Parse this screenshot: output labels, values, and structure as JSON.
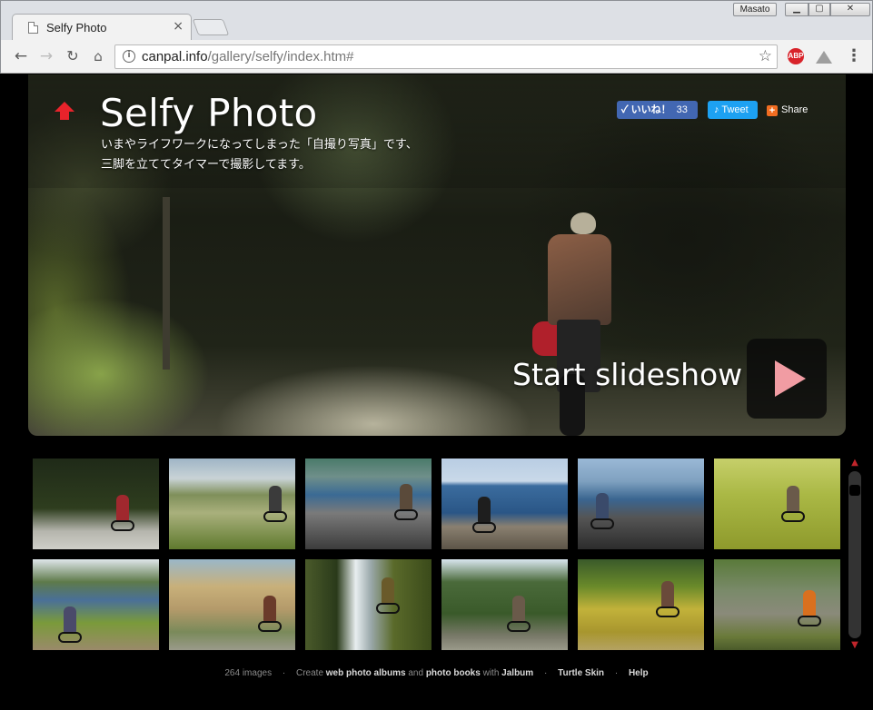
{
  "browser": {
    "tab_title": "Selfy Photo",
    "tab_close": "×",
    "profile_name": "Masato",
    "url_host": "canpal.info",
    "url_path": "/gallery/selfy/index.htm#",
    "icons": [
      "page-icon",
      "back-icon",
      "forward-icon",
      "reload-icon",
      "home-icon",
      "info-icon",
      "star-icon",
      "adblock-icon",
      "drive-icon",
      "menu-icon"
    ]
  },
  "hero": {
    "title": "Selfy Photo",
    "description_line1": "いまやライフワークになってしまった「自撮り写真」です、",
    "description_line2": "三脚を立ててタイマーで撮影してます。",
    "like_label": "いいね！",
    "like_count": "33",
    "tweet_label": "Tweet",
    "share_label": "Share",
    "slideshow_label": "Start slideshow",
    "accent_color": "#e8232b",
    "play_color": "#f19ca3"
  },
  "thumbnails": [
    {
      "scene": "forest-road"
    },
    {
      "scene": "park-steps"
    },
    {
      "scene": "seaside-road"
    },
    {
      "scene": "sea-backlit"
    },
    {
      "scene": "sea-road"
    },
    {
      "scene": "rice-field"
    },
    {
      "scene": "village-river"
    },
    {
      "scene": "old-house"
    },
    {
      "scene": "waterfall"
    },
    {
      "scene": "mountain-village"
    },
    {
      "scene": "rice-terrace"
    },
    {
      "scene": "rural-path"
    }
  ],
  "footer": {
    "count": "264 images",
    "create_text": "Create",
    "albums_link": "web photo albums",
    "and_text": "and",
    "books_link": "photo books",
    "with_text": "with",
    "jalbum_link": "Jalbum",
    "skin_link": "Turtle Skin",
    "help_link": "Help",
    "separator": "·"
  }
}
